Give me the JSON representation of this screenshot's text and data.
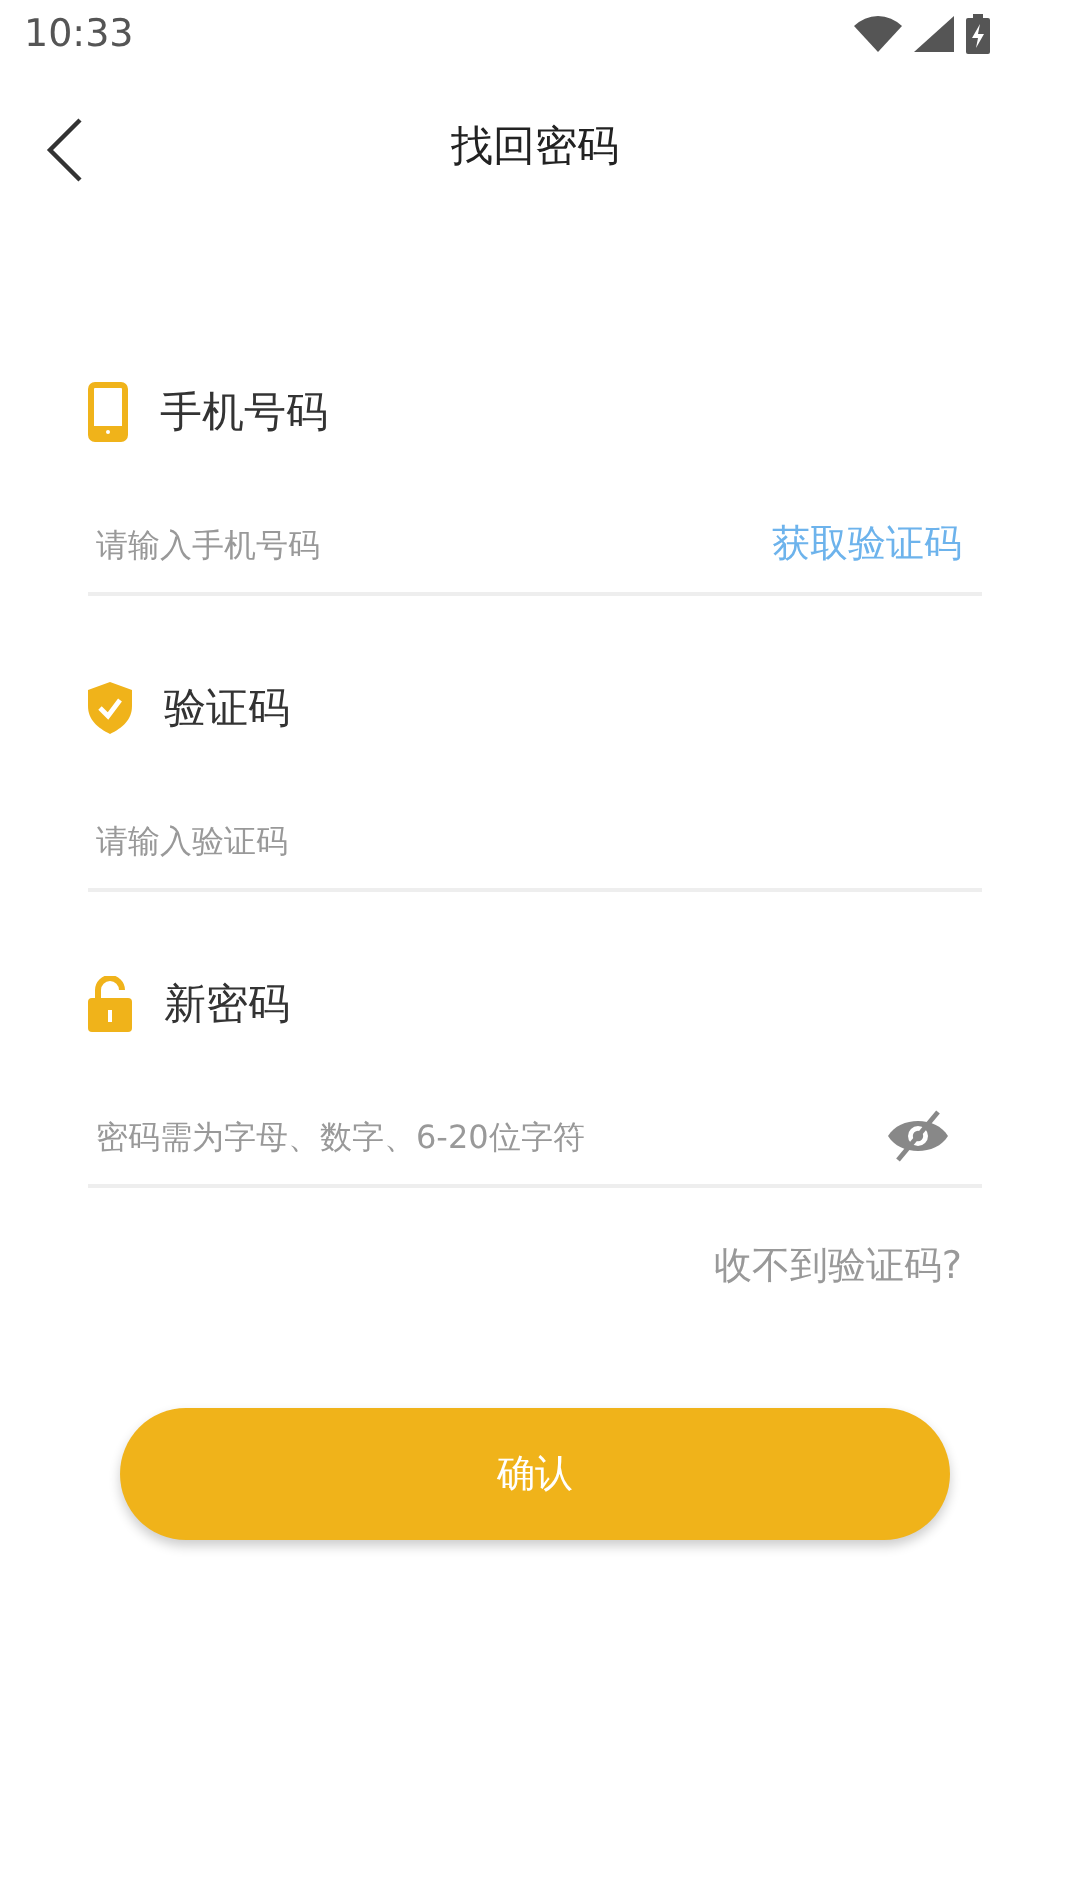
{
  "status_bar": {
    "time": "10:33"
  },
  "header": {
    "title": "找回密码"
  },
  "fields": [
    {
      "kind": "phone",
      "label": "手机号码",
      "placeholder": "请输入手机号码",
      "action": "获取验证码"
    },
    {
      "kind": "code",
      "label": "验证码",
      "placeholder": "请输入验证码"
    },
    {
      "kind": "password",
      "label": "新密码",
      "placeholder": "密码需为字母、数字、6-20位字符",
      "password_visible": false
    }
  ],
  "help_link": "收不到验证码?",
  "submit_button": "确认"
}
